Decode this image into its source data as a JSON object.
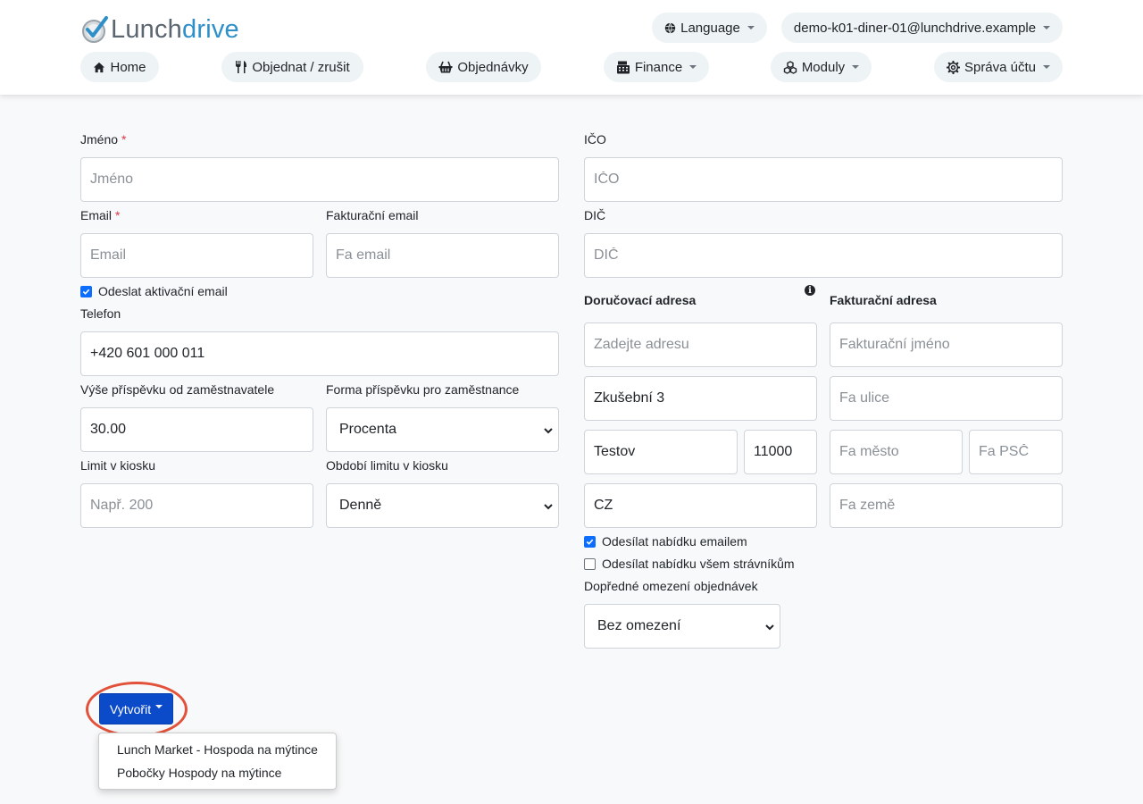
{
  "brand": {
    "part1": "Lunch",
    "part2": "drive"
  },
  "topnav": {
    "language": "Language",
    "user": "demo-k01-diner-01@lunchdrive.example"
  },
  "nav": {
    "home": "Home",
    "order": "Objednat / zrušit",
    "orders": "Objednávky",
    "finance": "Finance",
    "modules": "Moduly",
    "account": "Správa účtu"
  },
  "form": {
    "name": {
      "label": "Jméno",
      "required": "*",
      "placeholder": "Jméno",
      "value": ""
    },
    "email": {
      "label": "Email",
      "required": "*",
      "placeholder": "Email",
      "value": ""
    },
    "billing_email": {
      "label": "Fakturační email",
      "placeholder": "Fa email",
      "value": ""
    },
    "send_activation": {
      "label": "Odeslat aktivační email",
      "checked": true
    },
    "phone": {
      "label": "Telefon",
      "value": "+420 601 000 011"
    },
    "contribution": {
      "label": "Výše příspěvku od zaměstnavatele",
      "value": "30.00"
    },
    "contribution_form": {
      "label": "Forma příspěvku pro zaměstnance",
      "selected": "Procenta"
    },
    "kiosk_limit": {
      "label": "Limit v kiosku",
      "placeholder": "Např. 200",
      "value": ""
    },
    "kiosk_period": {
      "label": "Období limitu v kiosku",
      "selected": "Denně"
    },
    "ico": {
      "label": "IČO",
      "placeholder": "IČO",
      "value": ""
    },
    "dic": {
      "label": "DIČ",
      "placeholder": "DIČ",
      "value": ""
    },
    "delivery": {
      "heading": "Doručovací adresa",
      "address_placeholder": "Zadejte adresu",
      "street": "Zkušební 3",
      "city": "Testov",
      "zip": "11000",
      "country": "CZ"
    },
    "billing": {
      "heading": "Fakturační adresa",
      "name_placeholder": "Fakturační jméno",
      "street_placeholder": "Fa ulice",
      "city_placeholder": "Fa město",
      "zip_placeholder": "Fa PSČ",
      "country_placeholder": "Fa země"
    },
    "send_menu_email": {
      "label": "Odesílat nabídku emailem",
      "checked": true
    },
    "send_menu_all": {
      "label": "Odesílat nabídku všem strávníkům",
      "checked": false
    },
    "order_limit": {
      "label": "Dopředné omezení objednávek",
      "selected": "Bez omezení"
    }
  },
  "create": {
    "label": "Vytvořit",
    "menu": [
      "Lunch Market - Hospoda na mýtince",
      "Pobočky Hospody na mýtince"
    ]
  },
  "colors": {
    "primary": "#0b4ac9",
    "brand_blue": "#2e8fc9",
    "highlight": "#e2523a"
  }
}
